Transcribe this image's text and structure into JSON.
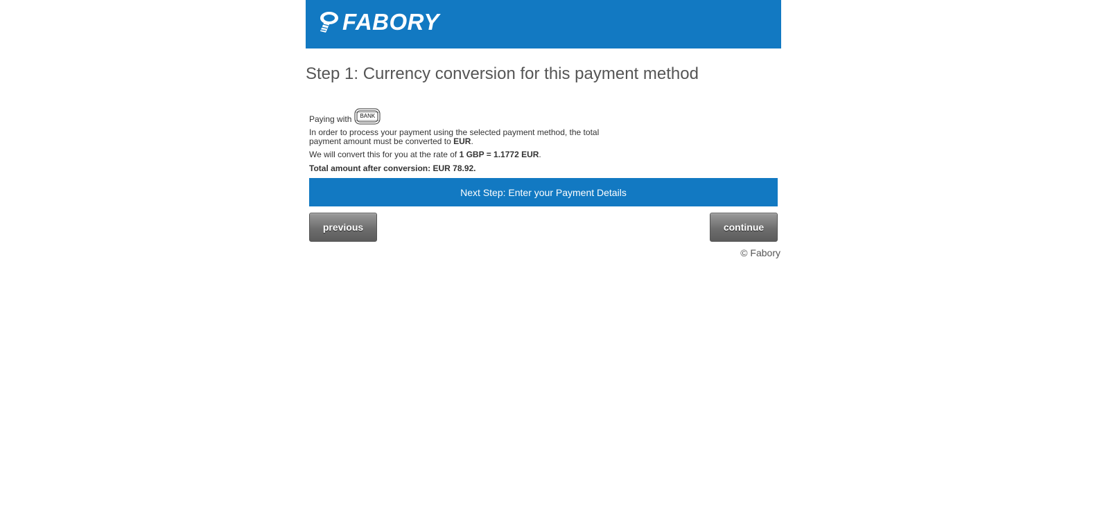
{
  "header": {
    "brand": "FABORY",
    "brand_color": "#1279c2"
  },
  "page": {
    "title": "Step 1: Currency conversion for this payment method"
  },
  "payment": {
    "paying_with": "Paying with",
    "method_logo_text": "BANK",
    "info_line": "In order to process your payment using the selected payment method, the total payment amount must be converted to",
    "target_currency": "EUR",
    "rate_prefix": "We will convert this for you at the rate of",
    "rate": "1 GBP = 1.1772 EUR",
    "total_label": "Total amount after conversion:",
    "total_value": "EUR 78.92."
  },
  "next_step": {
    "label": "Next Step: Enter your Payment Details"
  },
  "buttons": {
    "previous": "previous",
    "continue": "continue"
  },
  "footer": {
    "copyright": "© Fabory"
  }
}
